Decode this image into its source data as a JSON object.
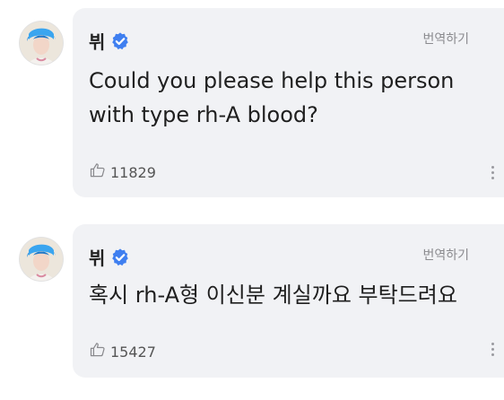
{
  "posts": [
    {
      "author": "뷔",
      "translate_label": "번역하기",
      "text": "Could you please help this person with type rh-A blood?",
      "likes": "11829",
      "verified_icon": "verified-badge-icon",
      "like_icon": "thumbs-up-icon",
      "more_icon": "more-vertical-icon"
    },
    {
      "author": "뷔",
      "translate_label": "번역하기",
      "text": "혹시 rh-A형 이신분 계실까요 부탁드려요",
      "likes": "15427",
      "verified_icon": "verified-badge-icon",
      "like_icon": "thumbs-up-icon",
      "more_icon": "more-vertical-icon"
    }
  ],
  "colors": {
    "card_bg": "#f1f2f5",
    "verified": "#3f7ff0",
    "text": "#1f1f1f",
    "muted": "#8a8a8e"
  }
}
